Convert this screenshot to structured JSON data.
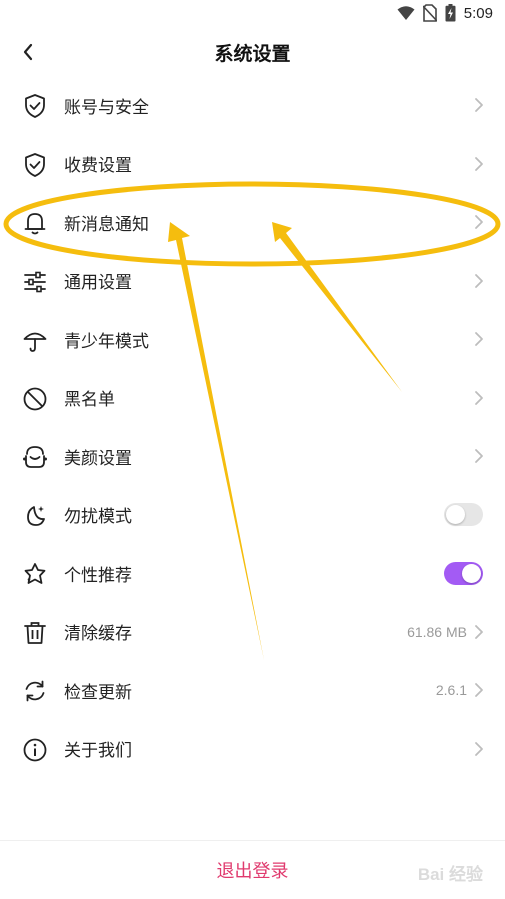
{
  "status_bar": {
    "time": "5:09",
    "icons": [
      "wifi-icon",
      "no-sim-icon",
      "battery-charging-icon"
    ]
  },
  "header": {
    "title": "系统设置",
    "back_icon": "back-chevron-icon"
  },
  "settings": [
    {
      "label": "账号与安全",
      "icon": "shield-check-icon",
      "trailing": "chevron"
    },
    {
      "label": "收费设置",
      "icon": "shield-check-icon",
      "trailing": "chevron"
    },
    {
      "label": "新消息通知",
      "icon": "bell-icon",
      "trailing": "chevron"
    },
    {
      "label": "通用设置",
      "icon": "sliders-icon",
      "trailing": "chevron"
    },
    {
      "label": "青少年模式",
      "icon": "umbrella-icon",
      "trailing": "chevron"
    },
    {
      "label": "黑名单",
      "icon": "block-icon",
      "trailing": "chevron"
    },
    {
      "label": "美颜设置",
      "icon": "beauty-face-icon",
      "trailing": "chevron"
    },
    {
      "label": "勿扰模式",
      "icon": "moon-star-icon",
      "trailing": "toggle",
      "toggle_on": false
    },
    {
      "label": "个性推荐",
      "icon": "star-badge-icon",
      "trailing": "toggle",
      "toggle_on": true
    },
    {
      "label": "清除缓存",
      "icon": "trash-icon",
      "trailing": "chevron",
      "value": "61.86 MB"
    },
    {
      "label": "检查更新",
      "icon": "refresh-icon",
      "trailing": "chevron",
      "value": "2.6.1"
    },
    {
      "label": "关于我们",
      "icon": "info-icon",
      "trailing": "chevron"
    }
  ],
  "footer": {
    "logout_label": "退出登录"
  },
  "colors": {
    "accent_toggle": "#a35bf4",
    "logout": "#e03a6e",
    "annotation": "#f5bd0e"
  },
  "watermark": {
    "text": "Bai 经验"
  }
}
